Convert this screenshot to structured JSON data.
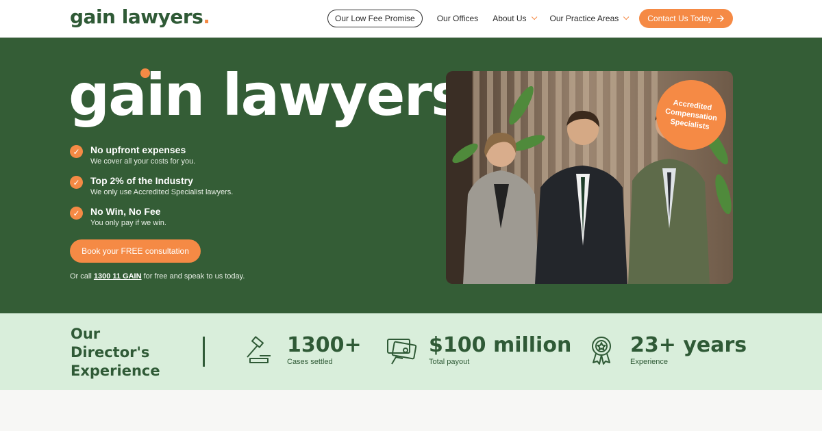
{
  "header": {
    "logo_text": "gain lawyers",
    "logo_dot": ".",
    "nav": [
      {
        "label": "Our Low Fee Promise"
      },
      {
        "label": "Our Offices"
      },
      {
        "label": "About Us"
      },
      {
        "label": "Our Practice Areas"
      }
    ],
    "cta_label": "Contact Us Today"
  },
  "hero": {
    "title": "gain lawyers",
    "title_dot": ".",
    "features": [
      {
        "title": "No upfront expenses",
        "desc": "We cover all your costs for you."
      },
      {
        "title": "Top 2% of the Industry",
        "desc": "We only use Accredited Specialist lawyers."
      },
      {
        "title": "No Win, No Fee",
        "desc": "You only pay if we win."
      }
    ],
    "book_label": "Book your FREE consultation",
    "call_prefix": "Or call ",
    "call_phone": "1300 11 GAIN",
    "call_suffix": " for free and speak to us today.",
    "badge": "Accredited Compensation Specialists"
  },
  "stats": {
    "title": "Our Director's Experience",
    "items": [
      {
        "value": "1300+",
        "label": "Cases settled",
        "icon": "gavel-icon"
      },
      {
        "value": "$100 million",
        "label": "Total payout",
        "icon": "payment-icon"
      },
      {
        "value": "23+ years",
        "label": "Experience",
        "icon": "award-icon"
      }
    ]
  },
  "colors": {
    "brand_green": "#345d36",
    "accent_orange": "#f58a45",
    "stats_bg": "#d9eedb"
  }
}
